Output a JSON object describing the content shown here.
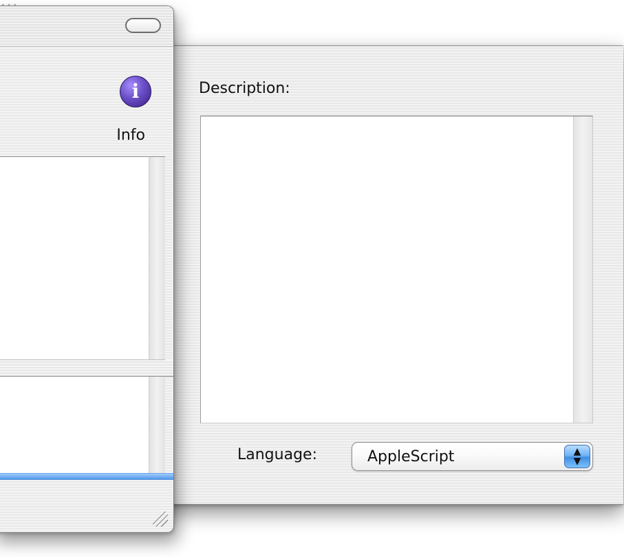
{
  "top_partial_text": "…",
  "left_window": {
    "info_label": "Info"
  },
  "right_window": {
    "description_label": "Description:",
    "language_label": "Language:",
    "language_value": "AppleScript"
  },
  "colors": {
    "info_icon": "#5b3fb6",
    "focus_ring": "#4c91e2",
    "stepper": "#3f8fe2"
  },
  "icons": {
    "info": "info-icon",
    "toolbar_toggle": "toolbar-toggle-icon",
    "resize": "resize-grip-icon",
    "stepper_up": "up-arrow-icon",
    "stepper_down": "down-arrow-icon"
  }
}
